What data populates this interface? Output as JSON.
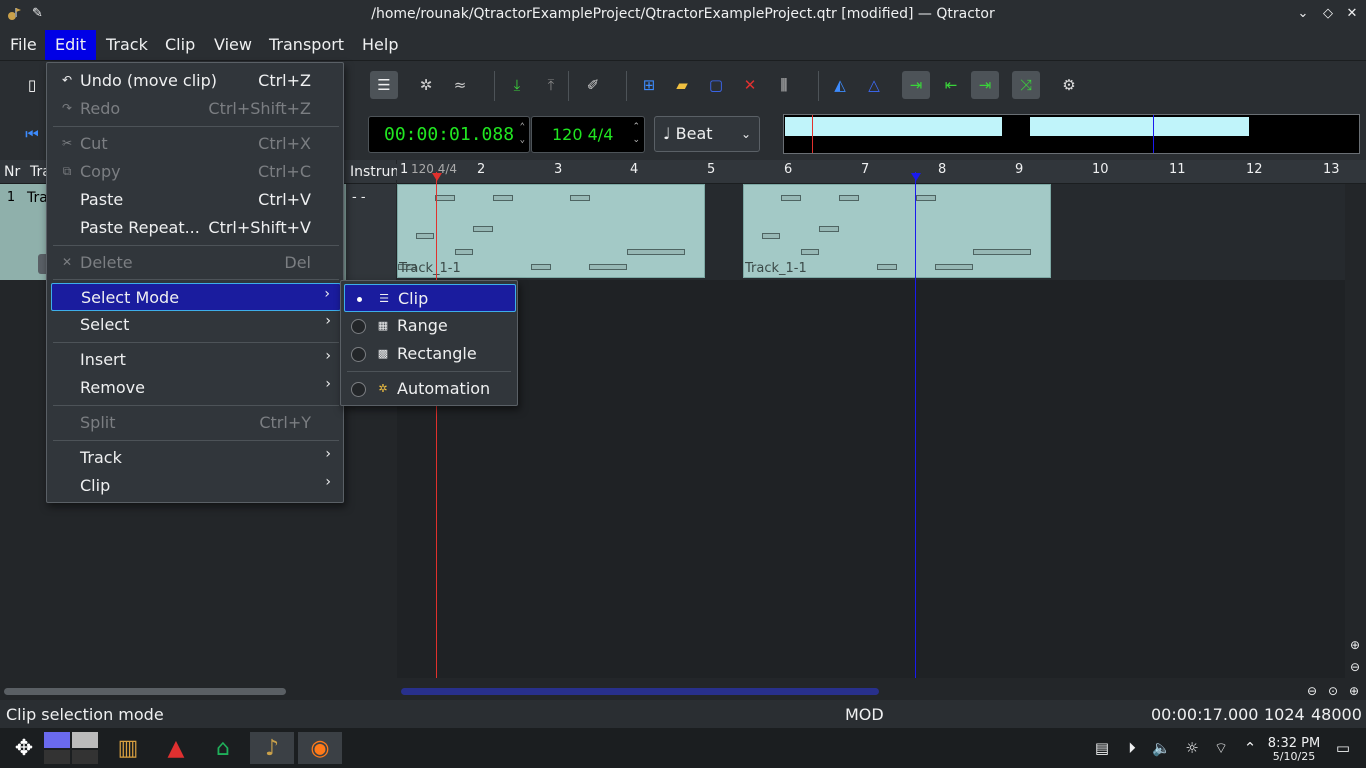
{
  "window": {
    "title": "/home/rounak/QtractorExampleProject/QtractorExampleProject.qtr [modified] — Qtractor"
  },
  "menubar": {
    "items": [
      "File",
      "Edit",
      "Track",
      "Clip",
      "View",
      "Transport",
      "Help"
    ],
    "active": "Edit"
  },
  "edit_menu": {
    "items": [
      {
        "label": "Undo (move clip)",
        "shortcut": "Ctrl+Z",
        "enabled": true,
        "icon": "undo-icon"
      },
      {
        "label": "Redo",
        "shortcut": "Ctrl+Shift+Z",
        "enabled": false,
        "icon": "redo-icon"
      },
      {
        "label": "Cut",
        "shortcut": "Ctrl+X",
        "enabled": false,
        "icon": "scissors-icon"
      },
      {
        "label": "Copy",
        "shortcut": "Ctrl+C",
        "enabled": false,
        "icon": "copy-icon"
      },
      {
        "label": "Paste",
        "shortcut": "Ctrl+V",
        "enabled": true,
        "icon": ""
      },
      {
        "label": "Paste Repeat...",
        "shortcut": "Ctrl+Shift+V",
        "enabled": true,
        "icon": ""
      },
      {
        "label": "Delete",
        "shortcut": "Del",
        "enabled": false,
        "icon": "delete-icon"
      },
      {
        "label": "Select Mode",
        "submenu": true,
        "highlight": true
      },
      {
        "label": "Select",
        "submenu": true
      },
      {
        "label": "Insert",
        "submenu": true
      },
      {
        "label": "Remove",
        "submenu": true
      },
      {
        "label": "Split",
        "shortcut": "Ctrl+Y",
        "enabled": false
      },
      {
        "label": "Track",
        "submenu": true
      },
      {
        "label": "Clip",
        "submenu": true
      }
    ]
  },
  "select_mode_menu": {
    "items": [
      {
        "label": "Clip",
        "checked": true
      },
      {
        "label": "Range",
        "checked": false
      },
      {
        "label": "Rectangle",
        "checked": false
      },
      {
        "label": "Automation",
        "checked": false
      }
    ]
  },
  "transport": {
    "time": "00:00:01.088",
    "tempo": "120 4/4",
    "snap": "Beat",
    "snap_glyph": "♩"
  },
  "tracklist": {
    "col_number": "Nr",
    "col_name": "Track Name",
    "col_instrument": "Instrument",
    "track_number": "1",
    "track_name": "Track 1",
    "instrument": "- -"
  },
  "ruler": {
    "marks": [
      "1",
      "2",
      "3",
      "4",
      "5",
      "6",
      "7",
      "8",
      "9",
      "10",
      "11",
      "12",
      "13"
    ],
    "tempo_marker": "120 4/4"
  },
  "clips": [
    {
      "label": "Track_1-1"
    },
    {
      "label": "Track_1-1"
    }
  ],
  "status": {
    "message": "Clip selection mode",
    "mod": "MOD",
    "duration": "00:00:17.000",
    "buffer": "1024",
    "sample_rate": "48000"
  },
  "clock": {
    "time": "8:32 PM",
    "date": "5/10/25"
  },
  "colors": {
    "accent": "#3daee9",
    "menu_active": "#0000e6",
    "clip": "#a3c9c6",
    "time_display": "#21e621",
    "playhead": "#e0312d",
    "edit_marker": "#1a1aee"
  }
}
